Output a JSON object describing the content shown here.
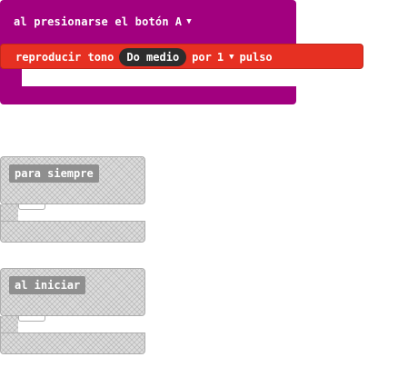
{
  "event_button": {
    "label": "al presionarse el botón",
    "button": "A"
  },
  "play_tone": {
    "label_prefix": "reproducir tono",
    "note": "Do medio",
    "label_mid": "por",
    "beats": "1",
    "label_suffix": "pulso"
  },
  "forever": {
    "label": "para siempre"
  },
  "on_start": {
    "label": "al iniciar"
  },
  "colors": {
    "input_purple": "#a2007f",
    "music_red": "#e63022",
    "disabled_grey": "#dcdcdc"
  },
  "icons": {
    "dropdown": "caret-down-icon"
  }
}
